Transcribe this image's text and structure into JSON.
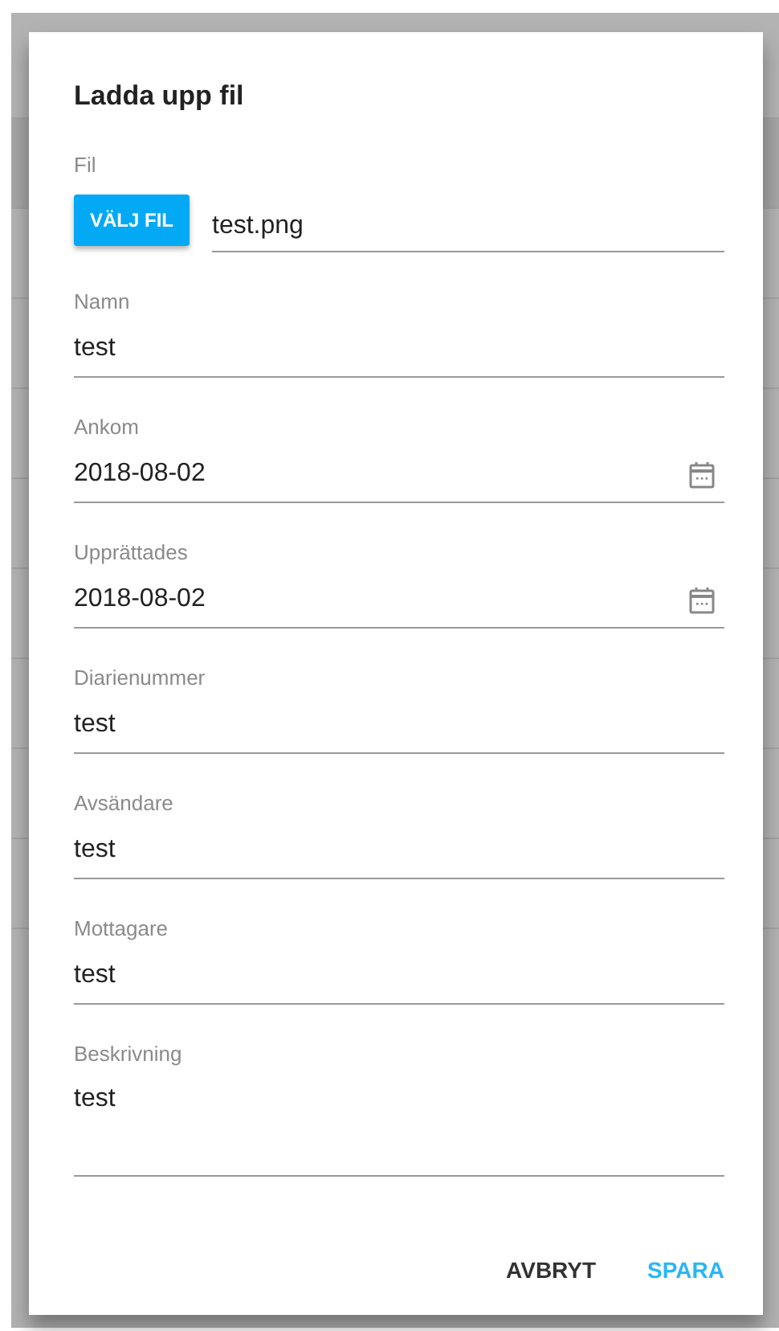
{
  "dialog": {
    "title": "Ladda upp fil",
    "fields": [
      {
        "kind": "file",
        "label": "Fil",
        "button": "VÄLJ FIL",
        "value": "test.png"
      },
      {
        "kind": "text",
        "label": "Namn",
        "value": "test"
      },
      {
        "kind": "date",
        "label": "Ankom",
        "value": "2018-08-02"
      },
      {
        "kind": "date",
        "label": "Upprättades",
        "value": "2018-08-02"
      },
      {
        "kind": "text",
        "label": "Diarienummer",
        "value": "test"
      },
      {
        "kind": "text",
        "label": "Avsändare",
        "value": "test"
      },
      {
        "kind": "text",
        "label": "Mottagare",
        "value": "test"
      },
      {
        "kind": "textarea",
        "label": "Beskrivning",
        "value": "test"
      }
    ],
    "buttons": [
      {
        "label": "AVBRYT",
        "primary": false
      },
      {
        "label": "SPARA",
        "primary": true
      }
    ]
  }
}
